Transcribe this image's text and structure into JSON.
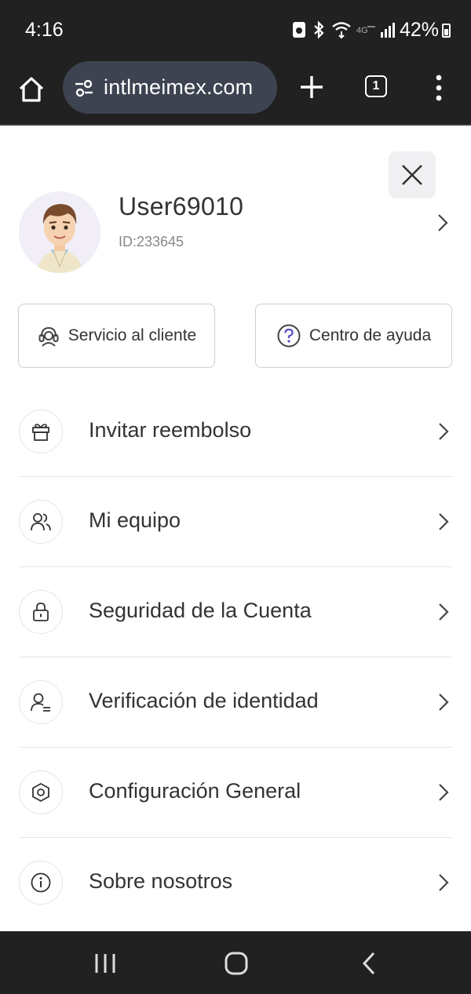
{
  "status_bar": {
    "time": "4:16",
    "battery": "42%",
    "icons": [
      "sim-icon",
      "bluetooth-icon",
      "wifi-icon",
      "lte-icon",
      "signal-icon",
      "battery-icon"
    ]
  },
  "browser": {
    "url": "intlmeimex.com",
    "tab_count": "1",
    "icons": [
      "home-icon",
      "site-settings-icon",
      "new-tab-icon",
      "tab-switcher-icon",
      "more-menu-icon"
    ]
  },
  "profile": {
    "username": "User69010",
    "user_id": "ID:233645"
  },
  "quick_actions": {
    "customer_service": "Servicio al cliente",
    "help_center": "Centro de ayuda"
  },
  "menu": [
    {
      "label": "Invitar reembolso",
      "icon": "gift-icon"
    },
    {
      "label": "Mi equipo",
      "icon": "team-icon"
    },
    {
      "label": "Seguridad de la Cuenta",
      "icon": "lock-icon"
    },
    {
      "label": "Verificación de identidad",
      "icon": "user-verify-icon"
    },
    {
      "label": "Configuración General",
      "icon": "settings-hex-icon"
    },
    {
      "label": "Sobre nosotros",
      "icon": "info-icon"
    }
  ],
  "colors": {
    "system_bar": "#212121",
    "url_pill": "#3d4350",
    "accent_purple": "#5b4fc4"
  }
}
